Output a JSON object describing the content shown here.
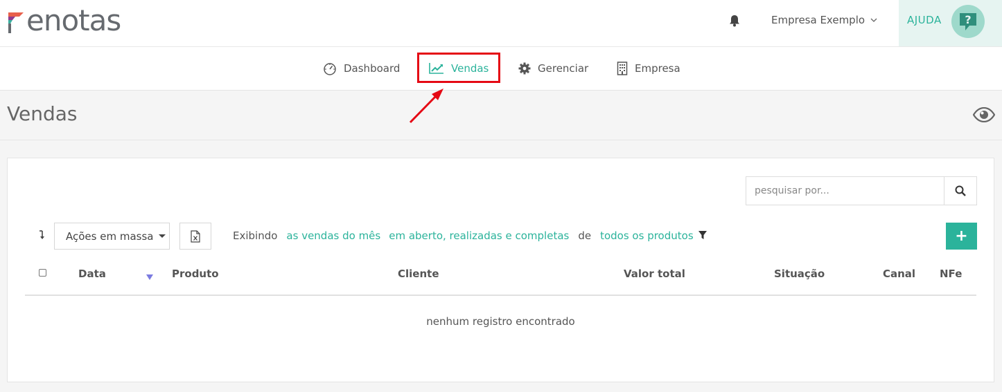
{
  "header": {
    "logo_text": "enotas",
    "company": "Empresa Exemplo",
    "help_label": "AJUDA",
    "help_avatar_glyph": "?"
  },
  "nav": {
    "items": [
      {
        "label": "Dashboard",
        "icon": "speedometer-icon"
      },
      {
        "label": "Vendas",
        "icon": "line-chart-icon",
        "active": true
      },
      {
        "label": "Gerenciar",
        "icon": "gear-icon"
      },
      {
        "label": "Empresa",
        "icon": "building-icon"
      }
    ]
  },
  "page": {
    "title": "Vendas"
  },
  "toolbar": {
    "search_placeholder": "pesquisar por...",
    "bulk_actions": "Ações em massa",
    "showing": "Exibindo",
    "filter_period": "as vendas do mês",
    "filter_status": "em aberto, realizadas e completas",
    "of": "de",
    "filter_products": "todos os produtos",
    "add_glyph": "+"
  },
  "table": {
    "columns": [
      "Data",
      "Produto",
      "Cliente",
      "Valor total",
      "Situação",
      "Canal",
      "NFe"
    ],
    "empty_message": "nenhum registro encontrado"
  },
  "colors": {
    "accent": "#2bb39b",
    "highlight": "#e50914",
    "sort_indicator": "#7b7be0"
  }
}
